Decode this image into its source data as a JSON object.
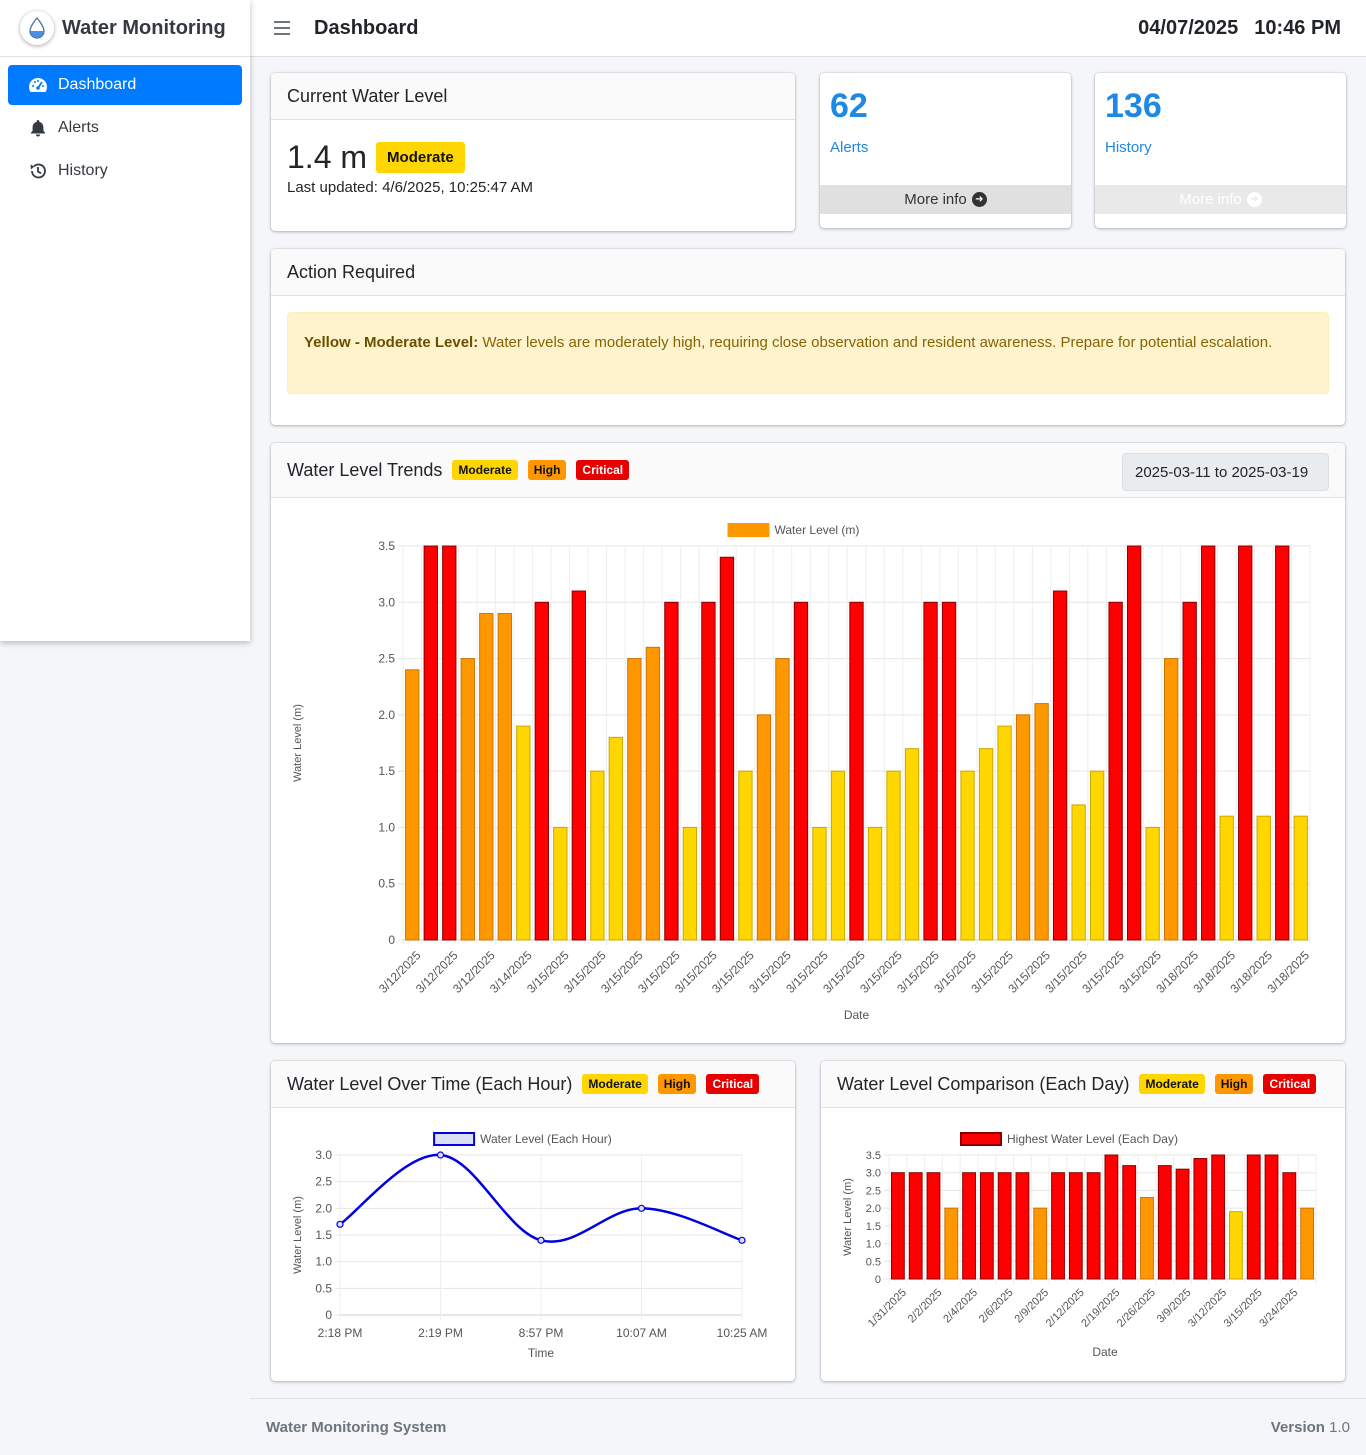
{
  "brand": {
    "name": "Water Monitoring"
  },
  "nav": [
    {
      "label": "Dashboard",
      "icon": "gauge-icon",
      "active": true
    },
    {
      "label": "Alerts",
      "icon": "bell-icon",
      "active": false
    },
    {
      "label": "History",
      "icon": "history-icon",
      "active": false
    }
  ],
  "header": {
    "title": "Dashboard",
    "date": "04/07/2025",
    "time": "10:46 PM"
  },
  "current": {
    "title": "Current Water Level",
    "value": "1.4 m",
    "status": "Moderate",
    "updated": "Last updated: 4/6/2025, 10:25:47 AM"
  },
  "stats": {
    "alerts": {
      "count": "62",
      "label": "Alerts",
      "more": "More info"
    },
    "history": {
      "count": "136",
      "label": "History",
      "more": "More info"
    }
  },
  "action": {
    "title": "Action Required",
    "strong": "Yellow - Moderate Level:",
    "text": " Water levels are moderately high, requiring close observation and resident awareness. Prepare for potential escalation."
  },
  "badges": {
    "moderate": "Moderate",
    "high": "High",
    "critical": "Critical"
  },
  "colors": {
    "moderate": "#ffd600",
    "high": "#ff9800",
    "critical": "#ff0000",
    "primary": "#007bff",
    "line": "#0000e0"
  },
  "trends": {
    "title": "Water Level Trends",
    "range": "2025-03-11 to 2025-03-19"
  },
  "hourly": {
    "title": "Water Level Over Time (Each Hour)"
  },
  "daily": {
    "title": "Water Level Comparison (Each Day)"
  },
  "footer": {
    "left": "Water Monitoring System",
    "version_label": "Version",
    "version": "1.0"
  },
  "chart_data": [
    {
      "type": "bar",
      "legend": "Water Level (m)",
      "xlabel": "Date",
      "ylabel": "Water Level (m)",
      "ylim": [
        0,
        3.5
      ],
      "yticks": [
        "0",
        "0.5",
        "1.0",
        "1.5",
        "2.0",
        "2.5",
        "3.0",
        "3.5"
      ],
      "legend_position": "top",
      "grid": true,
      "categories": [
        "3/12/2025",
        "3/12/2025",
        "3/12/2025",
        "3/12/2025",
        "3/12/2025",
        "3/14/2025",
        "3/14/2025",
        "3/15/2025",
        "3/15/2025",
        "3/15/2025",
        "3/15/2025",
        "3/15/2025",
        "3/15/2025",
        "3/15/2025",
        "3/15/2025",
        "3/15/2025",
        "3/15/2025",
        "3/15/2025",
        "3/15/2025",
        "3/15/2025",
        "3/15/2025",
        "3/15/2025",
        "3/15/2025",
        "3/15/2025",
        "3/15/2025",
        "3/15/2025",
        "3/15/2025",
        "3/15/2025",
        "3/15/2025",
        "3/15/2025",
        "3/15/2025",
        "3/15/2025",
        "3/15/2025",
        "3/15/2025",
        "3/15/2025",
        "3/15/2025",
        "3/15/2025",
        "3/15/2025",
        "3/15/2025",
        "3/15/2025",
        "3/15/2025",
        "3/15/2025",
        "3/18/2025",
        "3/18/2025",
        "3/18/2025",
        "3/18/2025",
        "3/18/2025",
        "3/18/2025",
        "3/18/2025",
        "3/18/2025",
        "3/18/2025",
        "3/18/2025"
      ],
      "values": [
        2.4,
        3.5,
        3.5,
        2.5,
        2.9,
        2.9,
        1.9,
        3.0,
        1.0,
        3.1,
        1.5,
        1.8,
        2.5,
        2.6,
        3.0,
        1.0,
        3.0,
        3.4,
        1.5,
        2.0,
        2.5,
        3.0,
        1.0,
        1.5,
        3.0,
        1.0,
        1.5,
        1.7,
        3.0,
        3.0,
        1.5,
        1.7,
        1.9,
        2.0,
        2.1,
        3.1,
        1.2,
        1.5,
        3.0,
        3.5,
        1.0,
        2.5,
        3.0,
        3.5,
        1.1,
        3.5,
        1.1,
        3.5,
        1.1
      ]
    },
    {
      "type": "line",
      "legend": "Water Level (Each Hour)",
      "xlabel": "Time",
      "ylabel": "Water Level (m)",
      "ylim": [
        0,
        3.0
      ],
      "yticks": [
        "0",
        "0.5",
        "1.0",
        "1.5",
        "2.0",
        "2.5",
        "3.0"
      ],
      "legend_position": "top",
      "grid": true,
      "categories": [
        "2:18 PM",
        "2:19 PM",
        "8:57 PM",
        "10:07 AM",
        "10:25 AM"
      ],
      "values": [
        1.7,
        3.0,
        1.4,
        2.0,
        1.4
      ]
    },
    {
      "type": "bar",
      "legend": "Highest Water Level (Each Day)",
      "xlabel": "Date",
      "ylabel": "Water Level (m)",
      "ylim": [
        0,
        3.5
      ],
      "yticks": [
        "0",
        "0.5",
        "1.0",
        "1.5",
        "2.0",
        "2.5",
        "3.0",
        "3.5"
      ],
      "legend_position": "top",
      "grid": true,
      "categories": [
        "1/31/2025",
        "",
        "2/2/2025",
        "",
        "2/4/2025",
        "",
        "2/6/2025",
        "",
        "2/9/2025",
        "",
        "2/12/2025",
        "",
        "2/19/2025",
        "",
        "2/26/2025",
        "",
        "3/9/2025",
        "",
        "3/12/2025",
        "",
        "3/15/2025",
        "",
        "3/24/2025",
        ""
      ],
      "values": [
        3.0,
        3.0,
        3.0,
        2.0,
        3.0,
        3.0,
        3.0,
        3.0,
        2.0,
        3.0,
        3.0,
        3.0,
        3.5,
        3.2,
        2.3,
        3.2,
        3.1,
        3.4,
        3.5,
        1.9,
        3.5,
        3.5,
        3.0,
        2.0
      ]
    }
  ]
}
